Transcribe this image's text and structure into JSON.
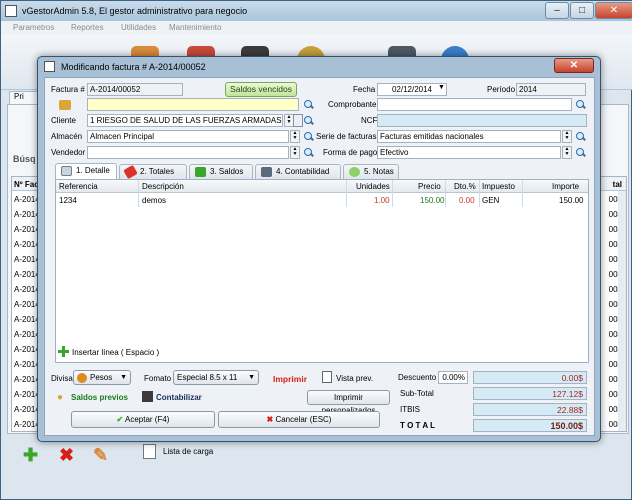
{
  "app": {
    "title": "vGestorAdmin 5.8,  El gestor administrativo para negocio",
    "controls": {
      "minimize": "–",
      "maximize": "□",
      "close": "✕"
    },
    "menu": [
      "Parametros",
      "Reportes",
      "Utilidades",
      "Mantenimiento"
    ],
    "tab_label": "Pri",
    "busqueda_label": "Búsq",
    "grid_header": {
      "left": "Nº Fac",
      "right": "tal"
    },
    "grid_rows": [
      {
        "left": "A-2014",
        "right": "00$"
      },
      {
        "left": "A-2014",
        "right": "00$"
      },
      {
        "left": "A-2014",
        "right": "00$"
      },
      {
        "left": "A-2014",
        "right": "00$"
      },
      {
        "left": "A-2014",
        "right": "00$"
      },
      {
        "left": "A-2014",
        "right": "00$"
      },
      {
        "left": "A-2014",
        "right": "00$"
      },
      {
        "left": "A-2014",
        "right": "00$"
      },
      {
        "left": "A-2014",
        "right": "00$"
      },
      {
        "left": "A-2014",
        "right": "00$"
      },
      {
        "left": "A-2014",
        "right": "00$"
      },
      {
        "left": "A-2014",
        "right": "00$"
      },
      {
        "left": "A-2014",
        "right": "00$"
      },
      {
        "left": "A-2014",
        "right": "00$"
      },
      {
        "left": "A-2014",
        "right": "00$"
      },
      {
        "left": "A-2014",
        "right": "00$"
      }
    ],
    "lista_carga": "Lista de carga"
  },
  "dialog": {
    "title": "Modificando factura # A-2014/00052",
    "close": "✕",
    "factura_label": "Factura #",
    "factura_value": "A-2014/00052",
    "saldos_vencidos": "Saldos vencidos",
    "fecha_label": "Fecha",
    "fecha_value": "02/12/2014",
    "periodo_label": "Período",
    "periodo_value": "2014",
    "comprobante_label": "Comprobante",
    "cliente_label": "Cliente",
    "cliente_value": "1 RIESGO DE SALUD DE LAS FUERZAS ARMADAS ARS",
    "ncf_label": "NCF",
    "almacen_label": "Almacén",
    "almacen_value": "Almacen Principal",
    "serie_label": "Serie de facturas",
    "serie_value": "Facturas emitidas nacionales",
    "vendedor_label": "Vendedor",
    "forma_pago_label": "Forma de pago",
    "forma_pago_value": "Efectivo",
    "tabs": [
      {
        "label": "1. Detalle"
      },
      {
        "label": "2. Totales"
      },
      {
        "label": "3. Saldos"
      },
      {
        "label": "4. Contabilidad"
      },
      {
        "label": "5. Notas"
      }
    ],
    "columns": {
      "referencia": "Referencia",
      "descripcion": "Descripción",
      "unidades": "Unidades",
      "precio": "Precio",
      "dto": "Dto.%",
      "impuesto": "Impuesto",
      "importe": "Importe"
    },
    "row": {
      "referencia": "1234",
      "descripcion": "demos",
      "unidades": "1.00",
      "precio": "150.00",
      "dto": "0.00",
      "impuesto": "GEN",
      "importe": "150.00"
    },
    "insertar_linea": "Insertar línea ( Espacio )",
    "divisa_label": "Divisa",
    "divisa_value": "Pesos",
    "formato_label": "Fomato",
    "formato_value": "Especial 8.5 x 11",
    "imprimir": "Imprimir",
    "vista_prev": "Vista prev.",
    "descuento_label": "Descuento",
    "descuento_pct": "0.00%",
    "descuento_value": "0.00$",
    "saldos_previos": "Saldos previos",
    "contabilizar": "Contabilizar",
    "imprimir_personalizados": "Imprimir personalizados",
    "subtotal_label": "Sub-Total",
    "subtotal_value": "127.12$",
    "itbis_label": "ITBIS",
    "itbis_value": "22.88$",
    "total_label": "T O T A L",
    "total_value": "150.00$",
    "aceptar": "Aceptar (F4)",
    "cancelar": "Cancelar (ESC)"
  }
}
